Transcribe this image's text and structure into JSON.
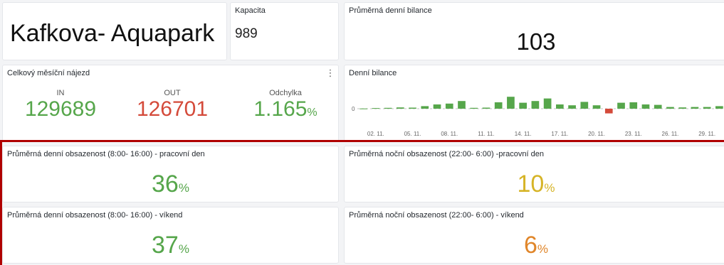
{
  "title_panel": {
    "title": "Kafkova- Aquapark"
  },
  "kapacita": {
    "label": "Kapacita",
    "value": "989"
  },
  "prumerna_bilance": {
    "label": "Průměrná denní bilance",
    "value": "103"
  },
  "mesicni_najezd": {
    "label": "Celkový měsíční nájezd",
    "in_label": "IN",
    "in_value": "129689",
    "out_label": "OUT",
    "out_value": "126701",
    "dev_label": "Odchylka",
    "dev_value": "1.165",
    "dev_unit": "%"
  },
  "denni_bilance": {
    "label": "Denní bilance"
  },
  "occupancy": {
    "day_workday": {
      "label": "Průměrná denní obsazenost (8:00- 16:00) - pracovní den",
      "value": "36",
      "unit": "%"
    },
    "night_workday": {
      "label": "Průměrná noční obsazenost (22:00- 6:00) -pracovní den",
      "value": "10",
      "unit": "%"
    },
    "day_weekend": {
      "label": "Průměrná denní obsazenost (8:00- 16:00) - víkend",
      "value": "37",
      "unit": "%"
    },
    "night_weekend": {
      "label": "Průměrná noční obsazenost (22:00- 6:00) - víkend",
      "value": "6",
      "unit": "%"
    }
  },
  "colors": {
    "green": "#56a64b",
    "red": "#d44a3a",
    "yellow": "#d6b427",
    "orange": "#e0862a",
    "highlight": "#b00000"
  },
  "icons": {
    "panel_menu": "more-vertical-icon"
  },
  "chart_data": {
    "type": "bar",
    "title": "Denní bilance",
    "y_ticks": [
      "0"
    ],
    "x_ticks": [
      "02. 11.",
      "05. 11.",
      "08. 11.",
      "11. 11.",
      "14. 11.",
      "17. 11.",
      "20. 11.",
      "23. 11.",
      "26. 11.",
      "29. 11."
    ],
    "categories": [
      "01. 11.",
      "02. 11.",
      "03. 11.",
      "04. 11.",
      "05. 11.",
      "06. 11.",
      "07. 11.",
      "08. 11.",
      "09. 11.",
      "10. 11.",
      "11. 11.",
      "12. 11.",
      "13. 11.",
      "14. 11.",
      "15. 11.",
      "16. 11.",
      "17. 11.",
      "18. 11.",
      "19. 11.",
      "20. 11.",
      "21. 11.",
      "22. 11.",
      "23. 11.",
      "24. 11.",
      "25. 11.",
      "26. 11.",
      "27. 11.",
      "28. 11.",
      "29. 11.",
      "30. 11."
    ],
    "values": [
      5,
      15,
      20,
      30,
      25,
      60,
      100,
      120,
      180,
      20,
      25,
      150,
      280,
      140,
      180,
      240,
      100,
      80,
      160,
      80,
      -110,
      140,
      150,
      100,
      90,
      40,
      30,
      40,
      40,
      60
    ],
    "ylim": [
      -250,
      450
    ],
    "grid": false,
    "legend": "none"
  }
}
